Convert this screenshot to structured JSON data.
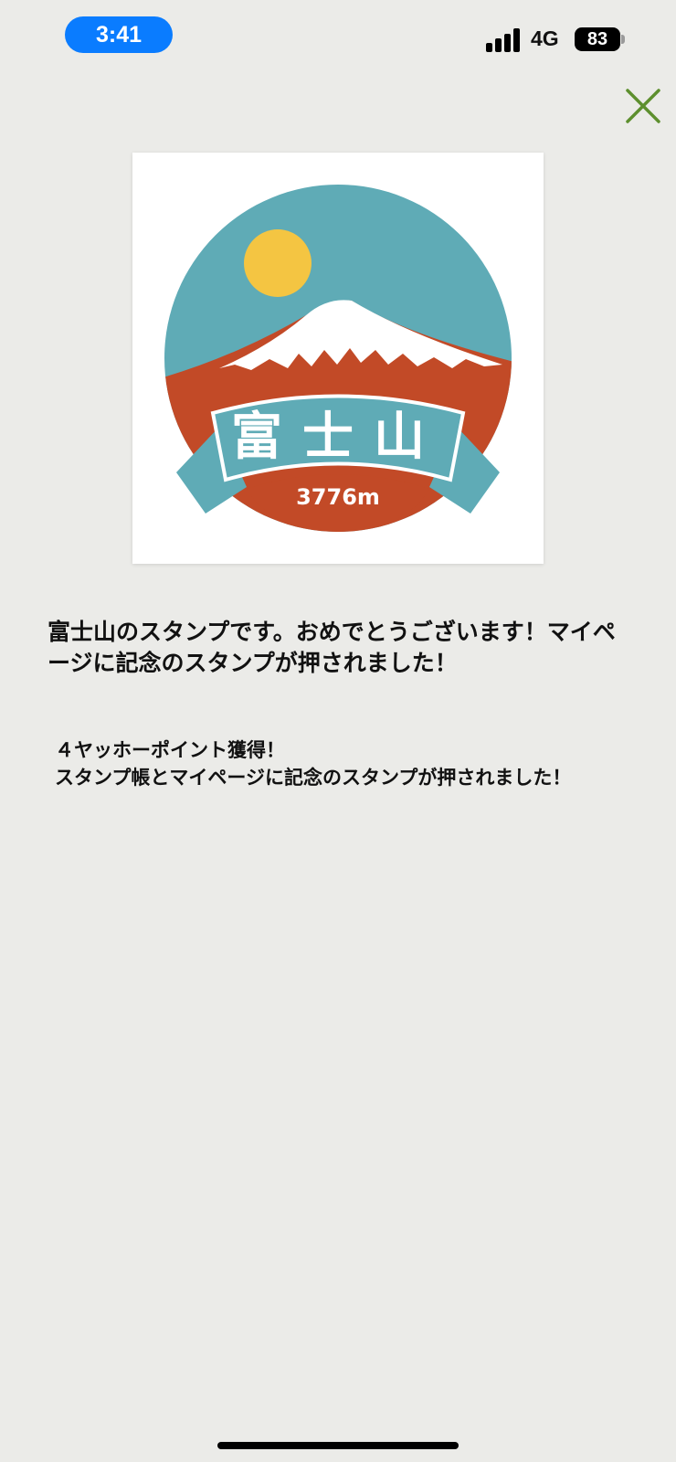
{
  "status_bar": {
    "time": "3:41",
    "network": "4G",
    "battery_percent": 83,
    "battery_label": "83"
  },
  "stamp": {
    "name": "富士山",
    "elevation": "3776m",
    "colors": {
      "sky": "#5fabb6",
      "sun": "#f4c542",
      "mountain": "#c24a27",
      "snow": "#ffffff"
    }
  },
  "message": "富士山のスタンプです。おめでとうございます！マイページに記念のスタンプが押されました！",
  "points": {
    "line1": "４ヤッホーポイント獲得！",
    "line2": "スタンプ帳とマイページに記念のスタンプが押されました！"
  },
  "close_icon_color": "#5d8f2e"
}
